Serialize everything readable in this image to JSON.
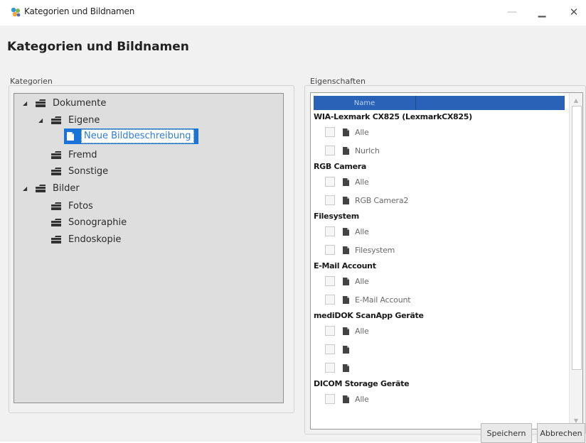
{
  "window": {
    "title": "Kategorien und Bildnamen",
    "minimize": "—",
    "maximize": "▁",
    "close": "✕"
  },
  "page": {
    "heading": "Kategorien und Bildnamen"
  },
  "categories": {
    "group_label": "Kategorien",
    "tree": {
      "dokumente": "Dokumente",
      "eigene": "Eigene",
      "neue_bildbeschreibung": "Neue Bildbeschreibung",
      "fremd": "Fremd",
      "sonstige": "Sonstige",
      "bilder": "Bilder",
      "fotos": "Fotos",
      "sonographie": "Sonographie",
      "endoskopie": "Endoskopie"
    },
    "expander_glyph": "◢"
  },
  "properties": {
    "group_label": "Eigenschaften",
    "column_header": "Name",
    "groups": [
      {
        "title": "WIA-Lexmark CX825 (LexmarkCX825)",
        "items": [
          "Alle",
          "Nurlch"
        ]
      },
      {
        "title": "RGB Camera",
        "items": [
          "Alle",
          "RGB Camera2"
        ]
      },
      {
        "title": "Filesystem",
        "items": [
          "Alle",
          "Filesystem"
        ]
      },
      {
        "title": "E-Mail Account",
        "items": [
          "Alle",
          "E-Mail Account"
        ]
      },
      {
        "title": "mediDOK ScanApp Geräte",
        "items": [
          "Alle",
          "",
          ""
        ]
      },
      {
        "title": "DICOM Storage Geräte",
        "items": [
          "Alle"
        ]
      }
    ],
    "scroll_up": "▲",
    "scroll_down": "▼"
  },
  "buttons": {
    "save": "Speichern",
    "cancel": "Abbrechen"
  },
  "colors": {
    "selection": "#1a73d8",
    "grid_header": "#2a62b8",
    "tree_background": "#dedede"
  }
}
